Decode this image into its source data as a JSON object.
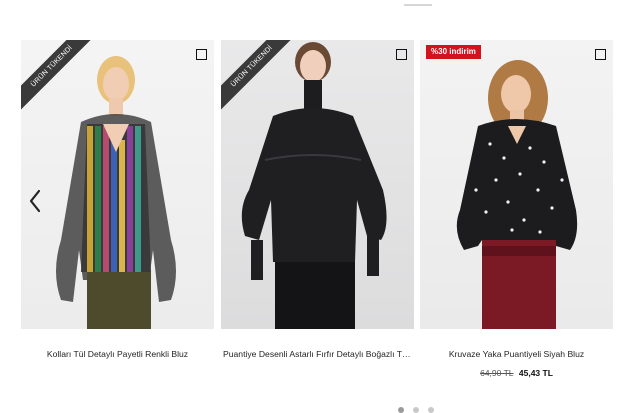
{
  "products": [
    {
      "title": "Kolları Tül Detaylı Payetli Renkli Bluz",
      "ribbon": "ÜRÜN TÜKENDİ",
      "discount": "",
      "old_price": "",
      "price": ""
    },
    {
      "title": "Puantiye Desenli Astarlı Fırfır Detaylı Boğazlı Tül...",
      "ribbon": "ÜRÜN TÜKENDİ",
      "discount": "",
      "old_price": "",
      "price": ""
    },
    {
      "title": "Kruvaze Yaka Puantiyeli Siyah Bluz",
      "ribbon": "",
      "discount": "%30 indirim",
      "old_price": "64,90 TL",
      "price": "45,43 TL"
    }
  ],
  "carousel": {
    "prev_icon": "chevron-left-icon",
    "compare_icon": "checkbox-square-icon",
    "page_count": 3,
    "active_page": 0
  },
  "colors": {
    "ribbon": "#3a3a3a",
    "discount_badge": "#d2121d",
    "dot_active": "#9a9a9a",
    "dot_inactive": "#c9c9c9"
  }
}
